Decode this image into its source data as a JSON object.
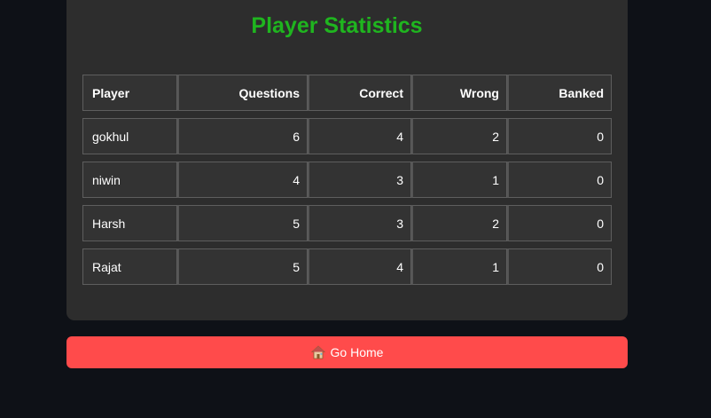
{
  "stats": {
    "title": "Player Statistics",
    "columns": [
      "Player",
      "Questions",
      "Correct",
      "Wrong",
      "Banked"
    ],
    "rows": [
      [
        "gokhul",
        "6",
        "4",
        "2",
        "0"
      ],
      [
        "niwin",
        "4",
        "3",
        "1",
        "0"
      ],
      [
        "Harsh",
        "5",
        "3",
        "2",
        "0"
      ],
      [
        "Rajat",
        "5",
        "4",
        "1",
        "0"
      ]
    ]
  },
  "actions": {
    "home_label": "Go Home",
    "home_icon": "house-icon",
    "home_color": "#ff4b4b"
  },
  "colors": {
    "background": "#0e1117",
    "panel": "#2d2d2d",
    "title": "#1fb51f"
  }
}
